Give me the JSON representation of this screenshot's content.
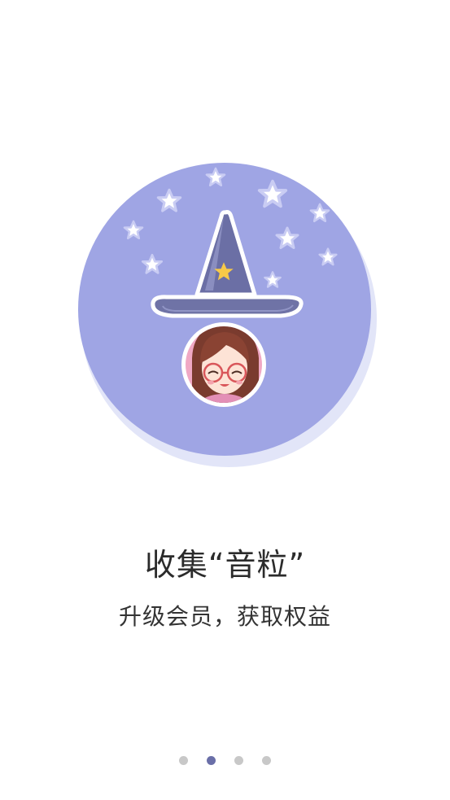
{
  "onboarding": {
    "title": "收集“音粒”",
    "subtitle": "升级会员，获取权益",
    "illustration": {
      "circle_color": "#9ea4e3",
      "shadow_color": "#dfe2f7",
      "hat_color": "#6f73a6",
      "star_color": "#ffffff",
      "hat_star_color": "#f7c948"
    }
  },
  "pager": {
    "total_pages": 4,
    "active_index": 1,
    "dots": [
      {
        "label": "page-1",
        "active": false
      },
      {
        "label": "page-2",
        "active": true
      },
      {
        "label": "page-3",
        "active": false
      },
      {
        "label": "page-4",
        "active": false
      }
    ],
    "active_color": "#6a6fa8",
    "inactive_color": "#c8c8c8"
  }
}
